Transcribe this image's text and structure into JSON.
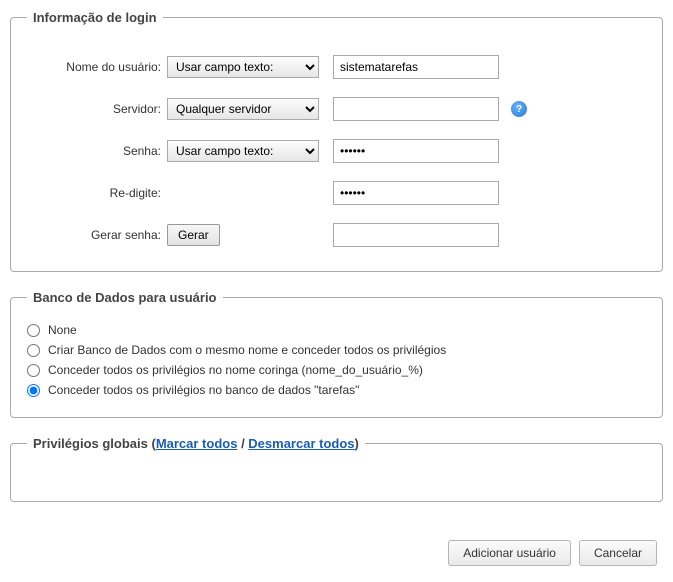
{
  "login": {
    "legend": "Informação de login",
    "username_label": "Nome do usuário:",
    "username_mode": "Usar campo texto:",
    "username_value": "sistematarefas",
    "server_label": "Servidor:",
    "server_mode": "Qualquer servidor",
    "server_value": "",
    "password_label": "Senha:",
    "password_mode": "Usar campo texto:",
    "password_value": "••••••",
    "retype_label": "Re-digite:",
    "retype_value": "••••••",
    "generate_label": "Gerar senha:",
    "generate_button": "Gerar",
    "generate_value": ""
  },
  "db": {
    "legend": "Banco de Dados para usuário",
    "opt1": "None",
    "opt2": "Criar Banco de Dados com o mesmo nome e conceder todos os privilégios",
    "opt3": "Conceder todos os privilégios no nome coringa (nome_do_usuário_%)",
    "opt4": "Conceder todos os privilégios no banco de dados \"tarefas\""
  },
  "gp": {
    "legend_prefix": "Privilégios globais (",
    "check_all": "Marcar todos",
    "sep": " / ",
    "uncheck_all": "Desmarcar todos",
    "legend_suffix": ")"
  },
  "footer": {
    "add": "Adicionar usuário",
    "cancel": "Cancelar"
  },
  "help_glyph": "?"
}
